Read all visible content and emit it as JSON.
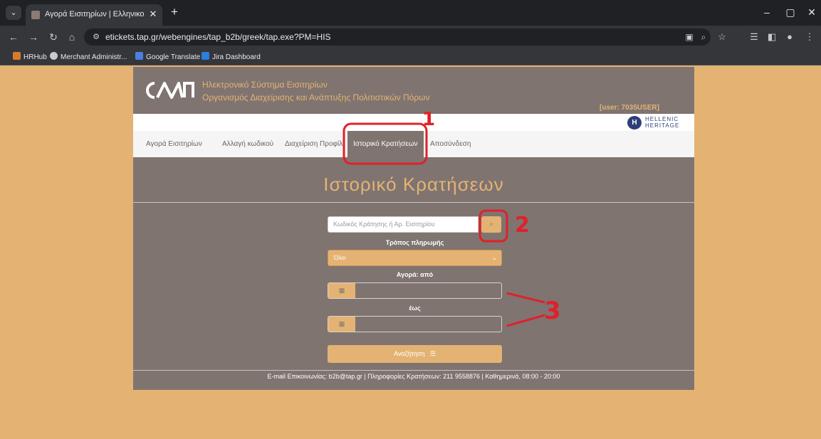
{
  "browser": {
    "tab_title": "Αγορά Εισιτηρίων | Ελληνικοί Α",
    "url": "etickets.tap.gr/webengines/tap_b2b/greek/tap.exe?PM=HIS",
    "bookmarks": [
      {
        "label": "HRHub",
        "icon": "hrhub-icon"
      },
      {
        "label": "Merchant Administr...",
        "icon": "globe-icon"
      },
      {
        "label": "Google Translate",
        "icon": "translate-icon"
      },
      {
        "label": "Jira Dashboard",
        "icon": "jira-icon"
      }
    ]
  },
  "header": {
    "logo_text": "ΤΑΠ",
    "brand_line1": "Ηλεκτρονικό Σύστημα Εισιτηρίων",
    "brand_line2": "Οργανισμός Διαχείρισης και Ανάπτυξης Πολιτιστικών Πόρων",
    "user": "[user: 7035USER]",
    "hh_line1": "HELLENIC",
    "hh_line2": "HERITAGE"
  },
  "nav": {
    "items": [
      {
        "label": "Αγορά Εισιτηρίων"
      },
      {
        "label": "Αλλαγή κωδικού"
      },
      {
        "label": "Διαχείριση Προφίλ"
      },
      {
        "label": "Ιστορικό Κρατήσεων"
      },
      {
        "label": "Αποσύνδεση"
      }
    ],
    "active_index": 3
  },
  "main": {
    "title": "Ιστορικό Κρατήσεων",
    "search_placeholder": "Κωδικός Κράτησης ή Αρ. Εισιτηρίου",
    "payment_label": "Τρόπος πληρωμής",
    "payment_selected": "Όλοι",
    "from_label": "Αγορά: από",
    "to_label": "έως",
    "submit_label": "Αναζήτηση"
  },
  "footer": {
    "text": "E-mail Επικοινωνίας: b2b@tap.gr | Πληροφορίες Κρατήσεων: 211 9558876 | Καθημερινά, 08:00 - 20:00"
  },
  "annotations": {
    "label_1": "1",
    "label_2": "2",
    "label_3": "3",
    "color": "#e0202a"
  },
  "colors": {
    "page_bg": "#e4b374",
    "panel": "#7f7470",
    "accent": "#e4b374"
  }
}
